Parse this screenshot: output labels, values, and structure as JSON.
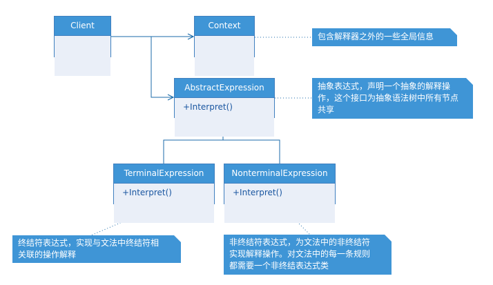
{
  "classes": {
    "client": {
      "name": "Client",
      "ops": []
    },
    "context": {
      "name": "Context",
      "ops": []
    },
    "abstract": {
      "name": "AbstractExpression",
      "ops": [
        "+Interpret()"
      ]
    },
    "terminal": {
      "name": "TerminalExpression",
      "ops": [
        "+Interpret()"
      ]
    },
    "nonterminal": {
      "name": "NonterminalExpression",
      "ops": [
        "+Interpret()"
      ]
    }
  },
  "notes": {
    "context": [
      "包含解释器之外的一些全局信息"
    ],
    "abstract": [
      "抽象表达式，声明一个抽象的解释操",
      "作，这个接口为抽象语法树中所有节点",
      "共享"
    ],
    "terminal": [
      "终结符表达式，实现与文法中终结符相",
      "关联的操作解释"
    ],
    "nonterminal": [
      "非终结符表达式，为文法中的非终结符",
      "实现解释操作。对文法中的每一条规则",
      "都需要一个非终结表达式类"
    ]
  },
  "colors": {
    "class_header": "#3f95d6",
    "class_body": "#eaeff8",
    "border": "#3f7fbf",
    "note_bg": "#3f95d6",
    "connector": "#1a6aa8"
  }
}
